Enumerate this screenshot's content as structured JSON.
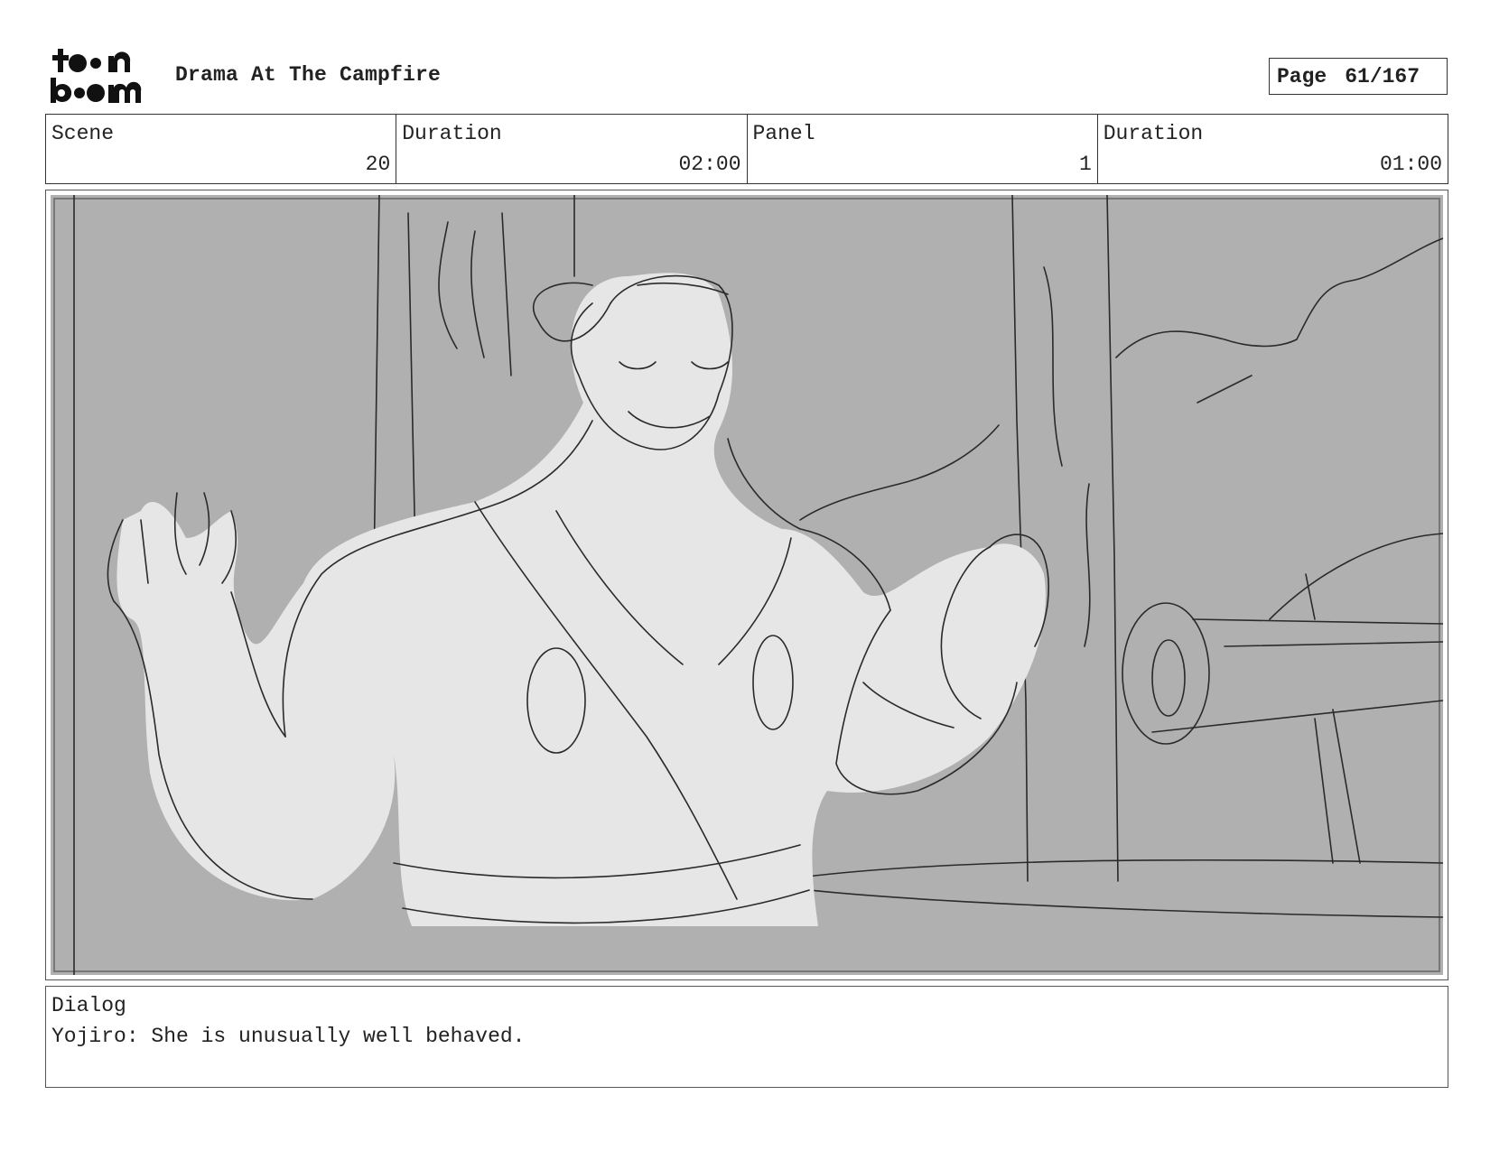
{
  "header": {
    "logo_text": "toonboom",
    "title": "Drama At The Campfire",
    "page_label": "Page",
    "page_value": "61/167"
  },
  "info": {
    "scene_label": "Scene",
    "scene_value": "20",
    "scene_duration_label": "Duration",
    "scene_duration_value": "02:00",
    "panel_label": "Panel",
    "panel_value": "1",
    "panel_duration_label": "Duration",
    "panel_duration_value": "01:00"
  },
  "dialog": {
    "label": "Dialog",
    "text": "Yojiro: She is unusually well behaved."
  },
  "colors": {
    "background_gray": "#b0b0b0",
    "figure_fill": "#e6e6e6",
    "line": "#2a2a2a"
  }
}
